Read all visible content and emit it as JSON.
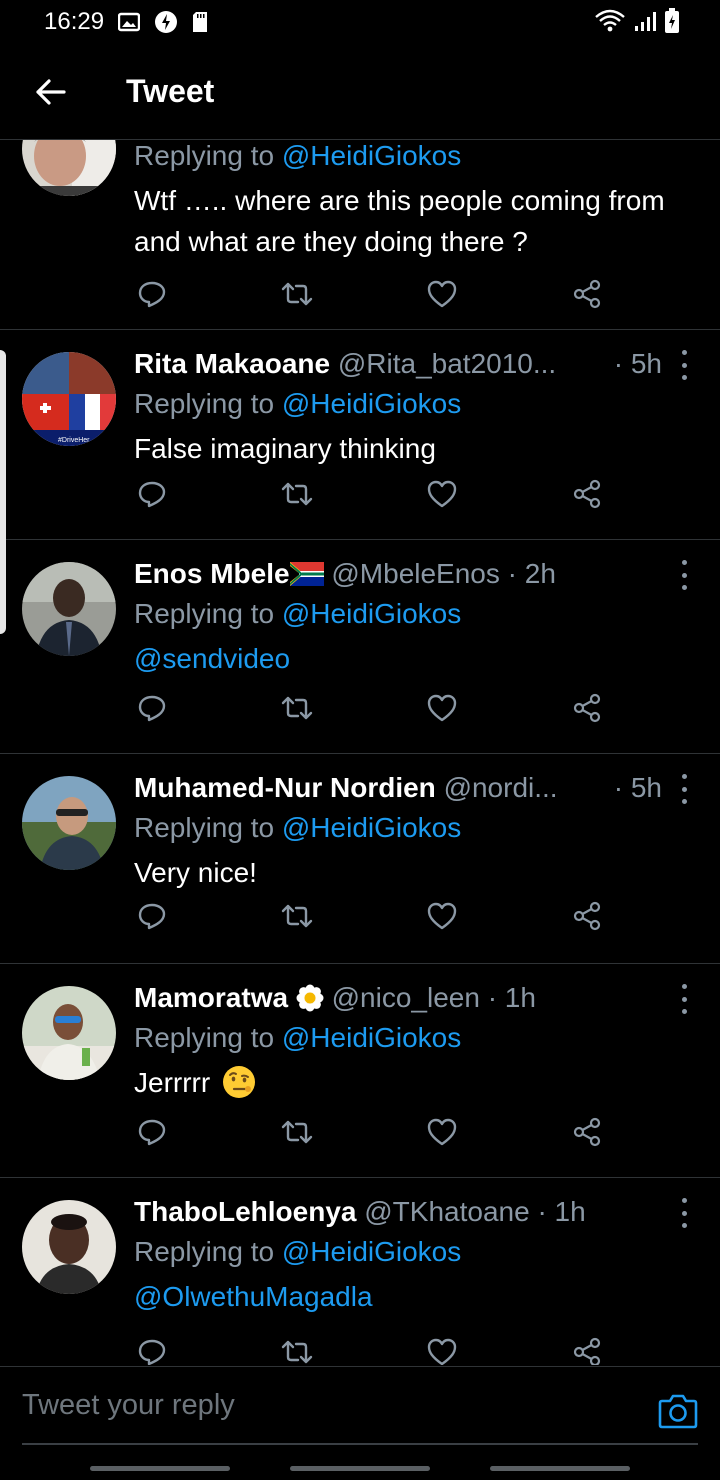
{
  "status_bar": {
    "time": "16:29"
  },
  "header": {
    "title": "Tweet"
  },
  "tweets": [
    {
      "name": "",
      "handle": "",
      "time": "",
      "replying_prefix": "Replying to",
      "replying_to": "@HeidiGiokos",
      "body": "Wtf ….. where are this people coming from and what are they doing there ?",
      "emoji_after_name": ""
    },
    {
      "name": "Rita Makaoane",
      "handle": "@Rita_bat2010...",
      "time": "· 5h",
      "replying_prefix": "Replying to",
      "replying_to": "@HeidiGiokos",
      "body": "False imaginary thinking"
    },
    {
      "name": "Enos Mbele",
      "handle": "@MbeleEnos",
      "time": "· 2h",
      "replying_prefix": "Replying to",
      "replying_to": "@HeidiGiokos",
      "body_mention": "@sendvideo"
    },
    {
      "name": "Muhamed-Nur Nordien",
      "handle": "@nordi...",
      "time": "· 5h",
      "replying_prefix": "Replying to",
      "replying_to": "@HeidiGiokos",
      "body": "Very nice!"
    },
    {
      "name": "Mamoratwa",
      "handle": "@nico_leen",
      "time": "· 1h",
      "replying_prefix": "Replying to",
      "replying_to": "@HeidiGiokos",
      "body": "Jerrrrr"
    },
    {
      "name": "ThaboLehloenya",
      "handle": "@TKhatoane",
      "time": "· 1h",
      "replying_prefix": "Replying to",
      "replying_to": "@HeidiGiokos",
      "body_mention": "@OlwethuMagadla"
    }
  ],
  "reply_bar": {
    "placeholder": "Tweet your reply"
  },
  "colors": {
    "background": "#000000",
    "accent": "#1d9bf0",
    "muted": "#8b98a5",
    "divider": "#2f3336"
  },
  "icons": [
    "back-arrow-icon",
    "reply-icon",
    "retweet-icon",
    "like-icon",
    "share-icon",
    "more-icon",
    "camera-icon",
    "south-africa-flag-icon",
    "sunflower-icon",
    "raised-eyebrow-emoji-icon"
  ]
}
